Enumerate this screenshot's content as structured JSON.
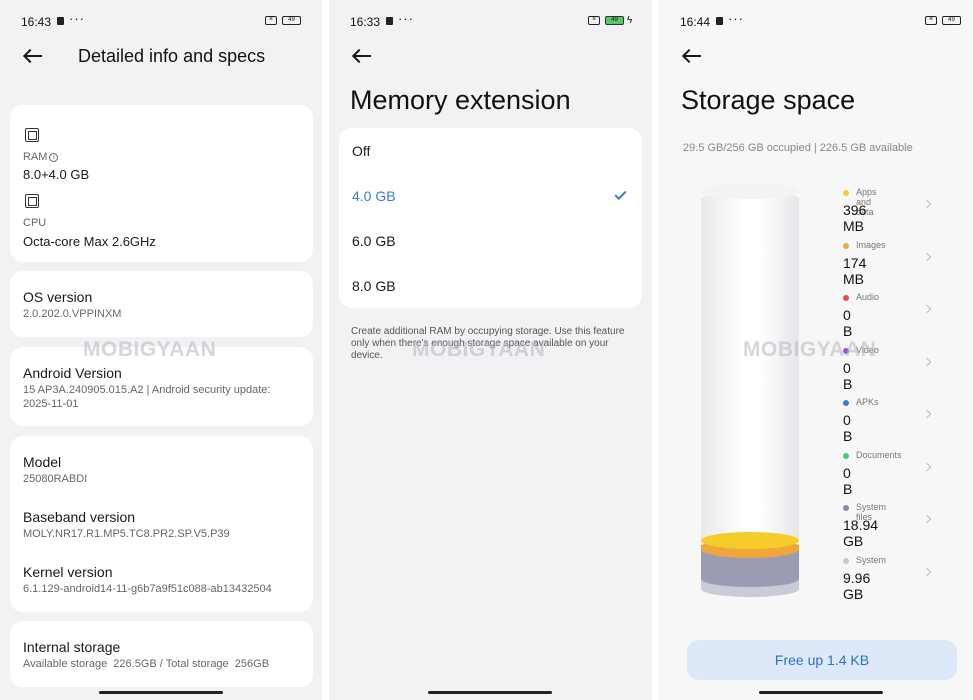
{
  "watermark": "MOBIGYAAN",
  "colors": {
    "accent": "#3a7bd5",
    "apps": "#f6cc2a",
    "images": "#f0a63a",
    "audio": "#e84b4b",
    "video": "#9a4fd4",
    "apks": "#3a7bd5",
    "documents": "#3ccf7a",
    "system_files": "#8a8aa6",
    "system": "#c4c6d4"
  },
  "panel1": {
    "status": {
      "time": "16:43",
      "battery": "49"
    },
    "title": "Detailed info and specs",
    "ram": {
      "label": "RAM",
      "info": "i",
      "value": "8.0+4.0 GB"
    },
    "cpu": {
      "label": "CPU",
      "value": "Octa-core Max 2.6GHz"
    },
    "os": {
      "label": "OS version",
      "value": "2.0.202.0.VPPINXM"
    },
    "android": {
      "label": "Android Version",
      "value": "15 AP3A.240905.015.A2 | Android security update: 2025-11-01"
    },
    "model": {
      "label": "Model",
      "value": "25080RABDI"
    },
    "baseband": {
      "label": "Baseband version",
      "value": "MOLY.NR17.R1.MP5.TC8.PR2.SP.V5.P39"
    },
    "kernel": {
      "label": "Kernel version",
      "value": "6.1.129-android14-11-g6b7a9f51c088-ab13432504"
    },
    "storage": {
      "label": "Internal storage",
      "value": "Available storage  226.5GB / Total storage  256GB"
    }
  },
  "panel2": {
    "status": {
      "time": "16:33",
      "battery": "49"
    },
    "title": "Memory extension",
    "options": [
      "Off",
      "4.0 GB",
      "6.0 GB",
      "8.0 GB"
    ],
    "selected_index": 1,
    "description": "Create additional RAM by occupying storage. Use this feature only when there's enough storage space available on your device."
  },
  "panel3": {
    "status": {
      "time": "16:44",
      "battery": "49"
    },
    "title": "Storage space",
    "summary": "29.5 GB/256 GB occupied | 226.5 GB available",
    "categories": [
      {
        "label": "Apps and data",
        "value": "396 MB",
        "color": "#f6cc2a"
      },
      {
        "label": "Images",
        "value": "174 MB",
        "color": "#f0a63a"
      },
      {
        "label": "Audio",
        "value": "0 B",
        "color": "#e84b4b"
      },
      {
        "label": "Video",
        "value": "0 B",
        "color": "#9a4fd4"
      },
      {
        "label": "APKs",
        "value": "0 B",
        "color": "#3a7bd5"
      },
      {
        "label": "Documents",
        "value": "0 B",
        "color": "#3ccf7a"
      },
      {
        "label": "System files",
        "value": "18.94 GB",
        "color": "#8a8aa6"
      },
      {
        "label": "System",
        "value": "9.96 GB",
        "color": "#c4c6d4"
      }
    ],
    "free_button": "Free up 1.4 KB"
  }
}
